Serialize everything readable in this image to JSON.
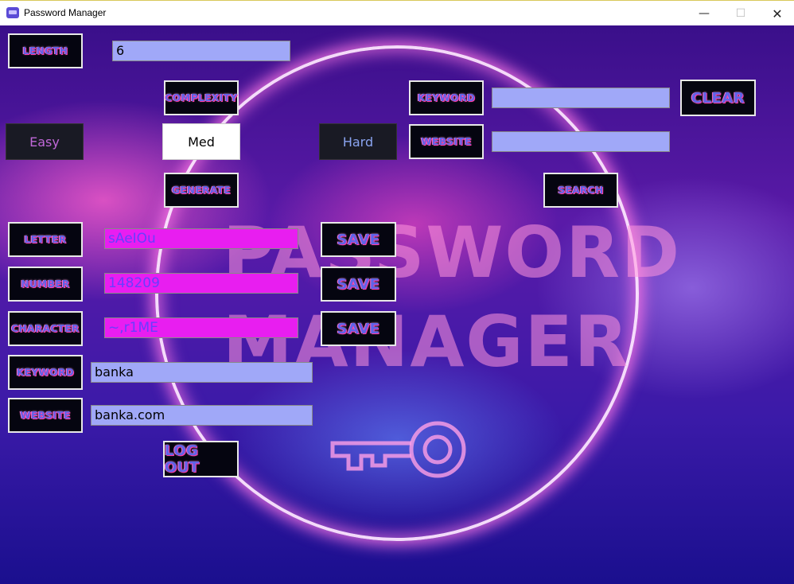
{
  "window": {
    "title": "Password Manager",
    "minimize": "—",
    "maximize": "☐",
    "close": "✕"
  },
  "background": {
    "title_line1": "PASSWORD",
    "title_line2": "MANAGER"
  },
  "generator": {
    "length_label": "LENGTH",
    "length_value": "6",
    "complexity_label": "COMPLEXITY",
    "options": [
      "Easy",
      "Med",
      "Hard"
    ],
    "selected": "Med",
    "generate_label": "GENERATE"
  },
  "search": {
    "keyword_label": "KEYWORD",
    "keyword_value": "",
    "website_label": "WEBSITE",
    "website_value": "",
    "clear_label": "CLEAR",
    "search_label": "SEARCH"
  },
  "parts": [
    {
      "label": "LETTER",
      "value": "sAeIOu",
      "save": "SAVE"
    },
    {
      "label": "NUMBER",
      "value": "148209",
      "save": "SAVE"
    },
    {
      "label": "CHARACTER",
      "value": "~,r1ME",
      "save": "SAVE"
    }
  ],
  "entry": {
    "keyword_label": "KEYWORD",
    "keyword_value": "banka",
    "website_label": "WEBSITE",
    "website_value": "banka.com"
  },
  "logout_label": "LOG OUT",
  "colors": {
    "field_blue": "#a0a8f8",
    "field_pink": "#e81ef0",
    "button_bg": "#050510",
    "button_text": "#5e64e8",
    "button_glow": "#ff3ba7"
  }
}
